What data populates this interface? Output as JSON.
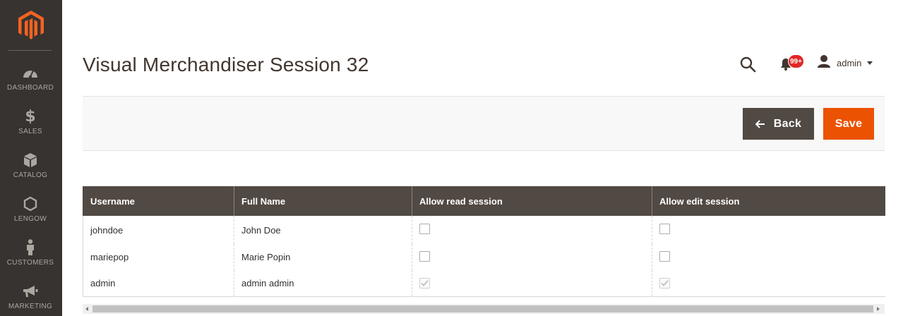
{
  "app": {
    "accent_color": "#eb5202",
    "sidebar_color": "#373330"
  },
  "sidebar": {
    "logo": "magento-logo",
    "items": [
      {
        "label": "DASHBOARD",
        "icon": "dashboard-icon"
      },
      {
        "label": "SALES",
        "icon": "dollar-icon"
      },
      {
        "label": "CATALOG",
        "icon": "box-icon"
      },
      {
        "label": "LENGOW",
        "icon": "hexagon-icon"
      },
      {
        "label": "CUSTOMERS",
        "icon": "person-icon"
      },
      {
        "label": "MARKETING",
        "icon": "megaphone-icon"
      }
    ]
  },
  "header": {
    "title": "Visual Merchandiser Session 32",
    "notifications_badge": "99+",
    "user_name": "admin"
  },
  "actions": {
    "back_label": "Back",
    "save_label": "Save"
  },
  "grid": {
    "columns": [
      "Username",
      "Full Name",
      "Allow read session",
      "Allow edit session"
    ],
    "rows": [
      {
        "username": "johndoe",
        "full_name": "John Doe",
        "allow_read": false,
        "allow_edit": false,
        "disabled": false
      },
      {
        "username": "mariepop",
        "full_name": "Marie Popin",
        "allow_read": false,
        "allow_edit": false,
        "disabled": false
      },
      {
        "username": "admin",
        "full_name": "admin admin",
        "allow_read": true,
        "allow_edit": true,
        "disabled": true
      }
    ]
  }
}
